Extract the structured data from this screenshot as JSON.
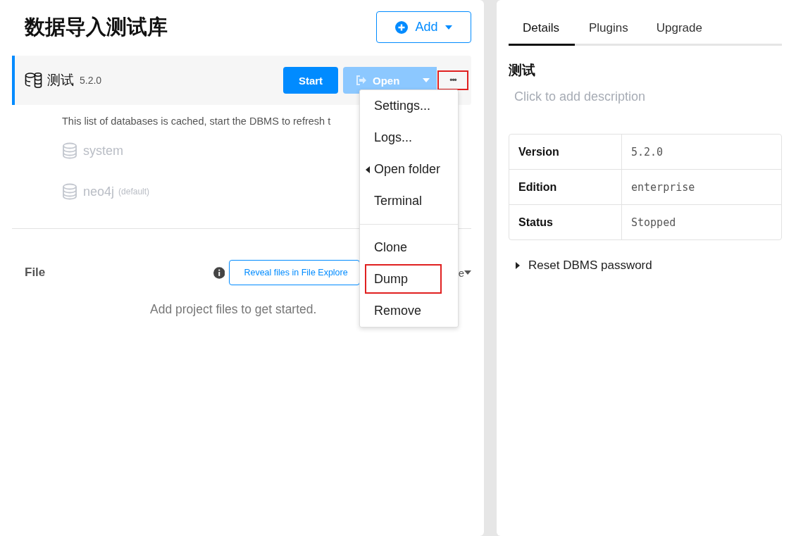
{
  "project": {
    "title": "数据导入测试库",
    "add_button": "Add"
  },
  "dbms": {
    "name": "测试",
    "version": "5.2.0",
    "active": true,
    "start_button": "Start",
    "open_button": "Open",
    "more_button": {
      "label": "•••",
      "highlighted": true
    }
  },
  "cached_notice": "This list of databases is cached, start the DBMS to refresh t",
  "databases": [
    {
      "name": "system"
    },
    {
      "name": "neo4j",
      "tag": "(default)"
    }
  ],
  "files": {
    "label": "File",
    "reveal_button": "Reveal files in File Explore",
    "fragment": "e",
    "empty_text": "Add project files to get started."
  },
  "menu": [
    {
      "label": "Settings...",
      "kind": "item",
      "highlighted": false
    },
    {
      "label": "Logs...",
      "kind": "item",
      "highlighted": false
    },
    {
      "label": "Open folder",
      "kind": "submenu",
      "highlighted": false
    },
    {
      "label": "Terminal",
      "kind": "item",
      "highlighted": false
    },
    {
      "kind": "divider"
    },
    {
      "label": "Clone",
      "kind": "item",
      "highlighted": false
    },
    {
      "label": "Dump",
      "kind": "item",
      "highlighted": true
    },
    {
      "label": "Remove",
      "kind": "item",
      "highlighted": false
    }
  ],
  "tabs": [
    {
      "label": "Details",
      "selected": true
    },
    {
      "label": "Plugins",
      "selected": false
    },
    {
      "label": "Upgrade",
      "selected": false
    }
  ],
  "details": {
    "heading": "测试",
    "description_placeholder": "Click to add description",
    "rows": [
      {
        "label": "Version",
        "value": "5.2.0"
      },
      {
        "label": "Edition",
        "value": "enterprise"
      },
      {
        "label": "Status",
        "value": "Stopped"
      }
    ],
    "reset_password": "Reset DBMS password"
  }
}
